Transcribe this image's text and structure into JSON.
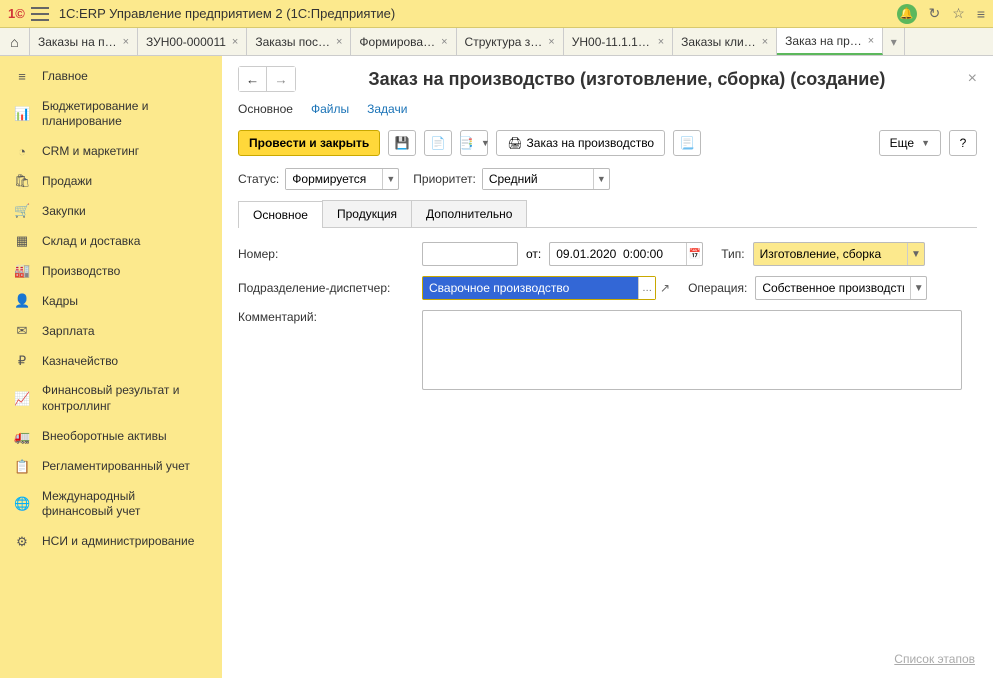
{
  "app_title": "1С:ERP Управление предприятием 2  (1С:Предприятие)",
  "tabs": [
    {
      "label": "Заказы на п…"
    },
    {
      "label": "ЗУН00-000011"
    },
    {
      "label": "Заказы пос…"
    },
    {
      "label": "Формирова…"
    },
    {
      "label": "Структура з…"
    },
    {
      "label": "УН00-11.1.1,…"
    },
    {
      "label": "Заказы кли…"
    },
    {
      "label": "Заказ на пр…",
      "active": true
    }
  ],
  "sidebar": [
    {
      "icon": "≡",
      "label": "Главное"
    },
    {
      "icon": "📊",
      "label": "Бюджетирование и планирование"
    },
    {
      "icon": "◔",
      "label": "CRM и маркетинг"
    },
    {
      "icon": "🛍",
      "label": "Продажи"
    },
    {
      "icon": "🛒",
      "label": "Закупки"
    },
    {
      "icon": "▦",
      "label": "Склад и доставка"
    },
    {
      "icon": "🏭",
      "label": "Производство"
    },
    {
      "icon": "👤",
      "label": "Кадры"
    },
    {
      "icon": "✉",
      "label": "Зарплата"
    },
    {
      "icon": "₽",
      "label": "Казначейство"
    },
    {
      "icon": "📈",
      "label": "Финансовый результат и контроллинг"
    },
    {
      "icon": "🚛",
      "label": "Внеоборотные активы"
    },
    {
      "icon": "📋",
      "label": "Регламентированный учет"
    },
    {
      "icon": "🌐",
      "label": "Международный финансовый учет"
    },
    {
      "icon": "⚙",
      "label": "НСИ и администрирование"
    }
  ],
  "page_title": "Заказ на производство (изготовление, сборка) (создание)",
  "links": {
    "main": "Основное",
    "files": "Файлы",
    "tasks": "Задачи"
  },
  "toolbar": {
    "post_close": "Провести и закрыть",
    "print_order": "Заказ на производство",
    "more": "Еще"
  },
  "status": {
    "label": "Статус:",
    "value": "Формируется",
    "priority_label": "Приоритет:",
    "priority_value": "Средний"
  },
  "doc_tabs": {
    "main": "Основное",
    "products": "Продукция",
    "extra": "Дополнительно"
  },
  "form": {
    "number_label": "Номер:",
    "number_value": "",
    "ot": "от:",
    "date_value": "09.01.2020  0:00:00",
    "type_label": "Тип:",
    "type_value": "Изготовление, сборка",
    "unit_label": "Подразделение-диспетчер:",
    "unit_value": "Сварочное производство",
    "op_label": "Операция:",
    "op_value": "Собственное производство",
    "comment_label": "Комментарий:",
    "comment_value": ""
  },
  "footer": "Список этапов"
}
